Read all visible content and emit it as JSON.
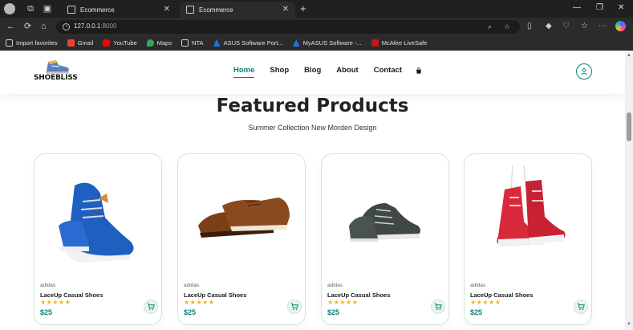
{
  "browser": {
    "tabs": [
      {
        "title": "Ecommerce",
        "active": false
      },
      {
        "title": "Ecommerce",
        "active": true
      }
    ],
    "url_host": "127.0.0.1",
    "url_port": ":8000",
    "bookmarks": [
      {
        "label": "Import favorites",
        "icon": "folder-icon"
      },
      {
        "label": "Gmail",
        "icon": "gmail-icon"
      },
      {
        "label": "YouTube",
        "icon": "youtube-icon"
      },
      {
        "label": "Maps",
        "icon": "maps-icon"
      },
      {
        "label": "NTA",
        "icon": "document-icon"
      },
      {
        "label": "ASUS Software Port...",
        "icon": "asus-icon"
      },
      {
        "label": "MyASUS Software -...",
        "icon": "asus-icon"
      },
      {
        "label": "McAfee LiveSafe",
        "icon": "mcafee-icon"
      }
    ]
  },
  "site": {
    "logo_text": "SHOEBLISS",
    "nav": [
      {
        "label": "Home",
        "active": true
      },
      {
        "label": "Shop",
        "active": false
      },
      {
        "label": "Blog",
        "active": false
      },
      {
        "label": "About",
        "active": false
      },
      {
        "label": "Contact",
        "active": false
      }
    ],
    "accent": "#088178"
  },
  "featured": {
    "title": "Featured Products",
    "subtitle": "Summer Collection New Morden Design",
    "products": [
      {
        "brand": "adidas",
        "name": "LaceUp Casual Shoes",
        "rating": 5,
        "price": "$25",
        "color": "#1f5fbf"
      },
      {
        "brand": "adidas",
        "name": "LaceUp Casual Shoes",
        "rating": 5,
        "price": "$25",
        "color": "#8a4a1f"
      },
      {
        "brand": "adidas",
        "name": "LaceUp Casual Shoes",
        "rating": 5,
        "price": "$25",
        "color": "#3f4747"
      },
      {
        "brand": "adidas",
        "name": "LaceUp Casual Shoes",
        "rating": 5,
        "price": "$25",
        "color": "#d8293b"
      }
    ]
  }
}
